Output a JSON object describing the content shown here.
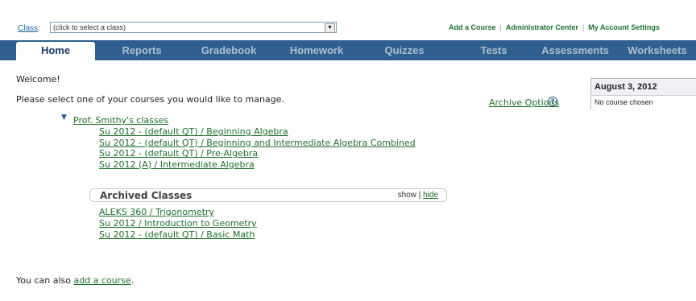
{
  "topbar": {
    "class_label": "Class",
    "class_colon": ":",
    "class_select_value": "(click to select a class)",
    "links": [
      "Add a Course",
      "Administrator Center",
      "My Account Settings"
    ]
  },
  "nav": {
    "tabs": [
      "Home",
      "Reports",
      "Gradebook",
      "Homework",
      "Quizzes",
      "Tests",
      "Assessments",
      "Worksheets"
    ]
  },
  "main": {
    "welcome": "Welcome!",
    "instruction": "Please select one of your courses you would like to manage.",
    "archive_options": "Archive Options",
    "help_glyph": "?",
    "expand_glyph": "▼",
    "group_title": "Prof. Smithy's classes",
    "courses": [
      "Su 2012 - (default QT) / Beginning Algebra",
      "Su 2012 - (default QT) / Beginning and Intermediate Algebra Combined",
      "Su 2012 - (default QT) / Pre-Algebra",
      "Su 2012 (A) / Intermediate Algebra"
    ],
    "archived": {
      "title": "Archived Classes",
      "show": "show",
      "separator": "|",
      "hide": "hide",
      "classes": [
        "ALEKS 360 / Trigonometry",
        "Su 2012 / Introduction to Geometry",
        "Su 2012 - (default QT) / Basic Math"
      ]
    },
    "footer_prefix": "You can also ",
    "footer_link": "add a course",
    "footer_suffix": "."
  },
  "date_panel": {
    "date": "August 3, 2012",
    "status": "No course chosen"
  }
}
